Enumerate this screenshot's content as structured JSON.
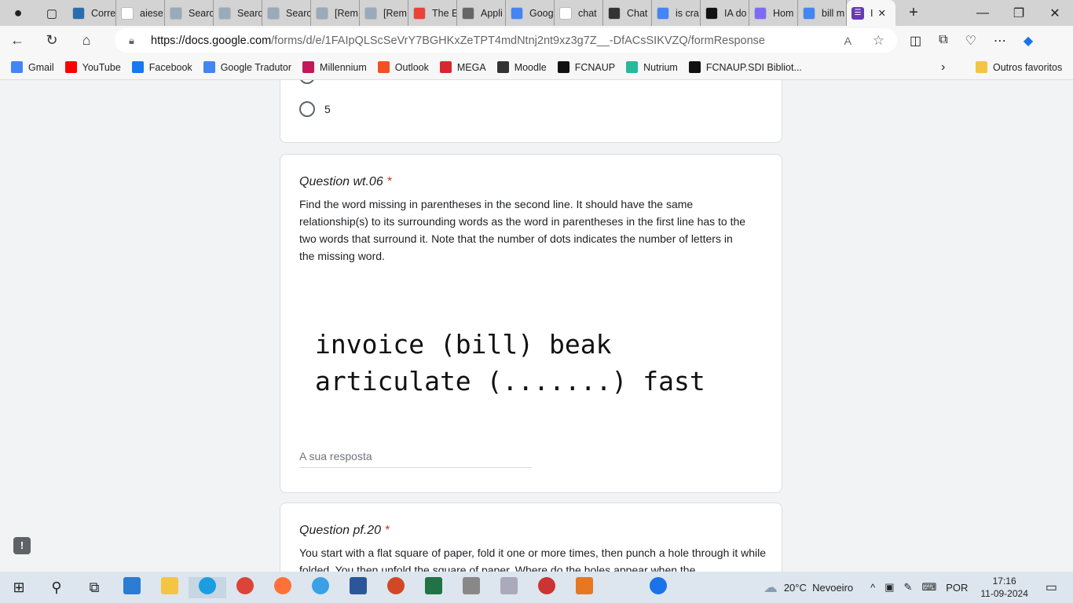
{
  "browser": {
    "tabs": [
      {
        "label": "Corre",
        "color": "#2b6cb0"
      },
      {
        "label": "aiese",
        "color": "#ffffff"
      },
      {
        "label": "Searc",
        "color": "#9ab"
      },
      {
        "label": "Searc",
        "color": "#9ab"
      },
      {
        "label": "Searc",
        "color": "#9ab"
      },
      {
        "label": "[Rem",
        "color": "#9ab"
      },
      {
        "label": "[Rem",
        "color": "#9ab"
      },
      {
        "label": "The E",
        "color": "#ea4335"
      },
      {
        "label": "Appli",
        "color": "#666"
      },
      {
        "label": "Goog",
        "color": "#4285f4"
      },
      {
        "label": "chat",
        "color": "#ffffff"
      },
      {
        "label": "Chat",
        "color": "#333"
      },
      {
        "label": "is cra",
        "color": "#4285f4"
      },
      {
        "label": "IA do",
        "color": "#111"
      },
      {
        "label": "Hom",
        "color": "#7b6cf6"
      },
      {
        "label": "bill m",
        "color": "#4285f4"
      }
    ],
    "active_tab": {
      "label": "I",
      "color": "#673ab7"
    },
    "url_host": "https://docs.google.com",
    "url_path": "/forms/d/e/1FAIpQLScSeVrY7BGHKxZeTPT4mdNtnj2nt9xz3g7Z__-DfACsSIKVZQ/formResponse",
    "bookmarks": [
      {
        "label": "Gmail",
        "color": "#4285f4"
      },
      {
        "label": "YouTube",
        "color": "#ff0000"
      },
      {
        "label": "Facebook",
        "color": "#1877f2"
      },
      {
        "label": "Google Tradutor",
        "color": "#4285f4"
      },
      {
        "label": "Millennium",
        "color": "#c2185b"
      },
      {
        "label": "Outlook",
        "color": "#f25022"
      },
      {
        "label": "MEGA",
        "color": "#d9272e"
      },
      {
        "label": "Moodle",
        "color": "#333"
      },
      {
        "label": "FCNAUP",
        "color": "#111"
      },
      {
        "label": "Nutrium",
        "color": "#26b99a"
      },
      {
        "label": "FCNAUP.SDI Bibliot...",
        "color": "#111"
      }
    ],
    "other_favorites": "Outros favoritos"
  },
  "form": {
    "prev_option": "5",
    "question1": {
      "title": "Question wt.06",
      "required": "*",
      "description": "Find the word missing in parentheses in the second line. It should have the same relationship(s) to its surrounding words as the word in parentheses in the first line has to the two words that surround it. Note that the number of dots indicates the number of letters in the missing word.",
      "image_line1": "invoice (bill) beak",
      "image_line2": "articulate (.......) fast",
      "answer_placeholder": "A sua resposta"
    },
    "question2": {
      "title": "Question pf.20",
      "required": "*",
      "description": "You start with a flat square of paper, fold it one or more times, then punch a hole through it while folded. You then unfold the square of paper. Where do the holes appear when the"
    }
  },
  "taskbar": {
    "weather": "20°C  Nevoeiro",
    "lang": "POR",
    "time": "17:16",
    "date": "11-09-2024"
  }
}
